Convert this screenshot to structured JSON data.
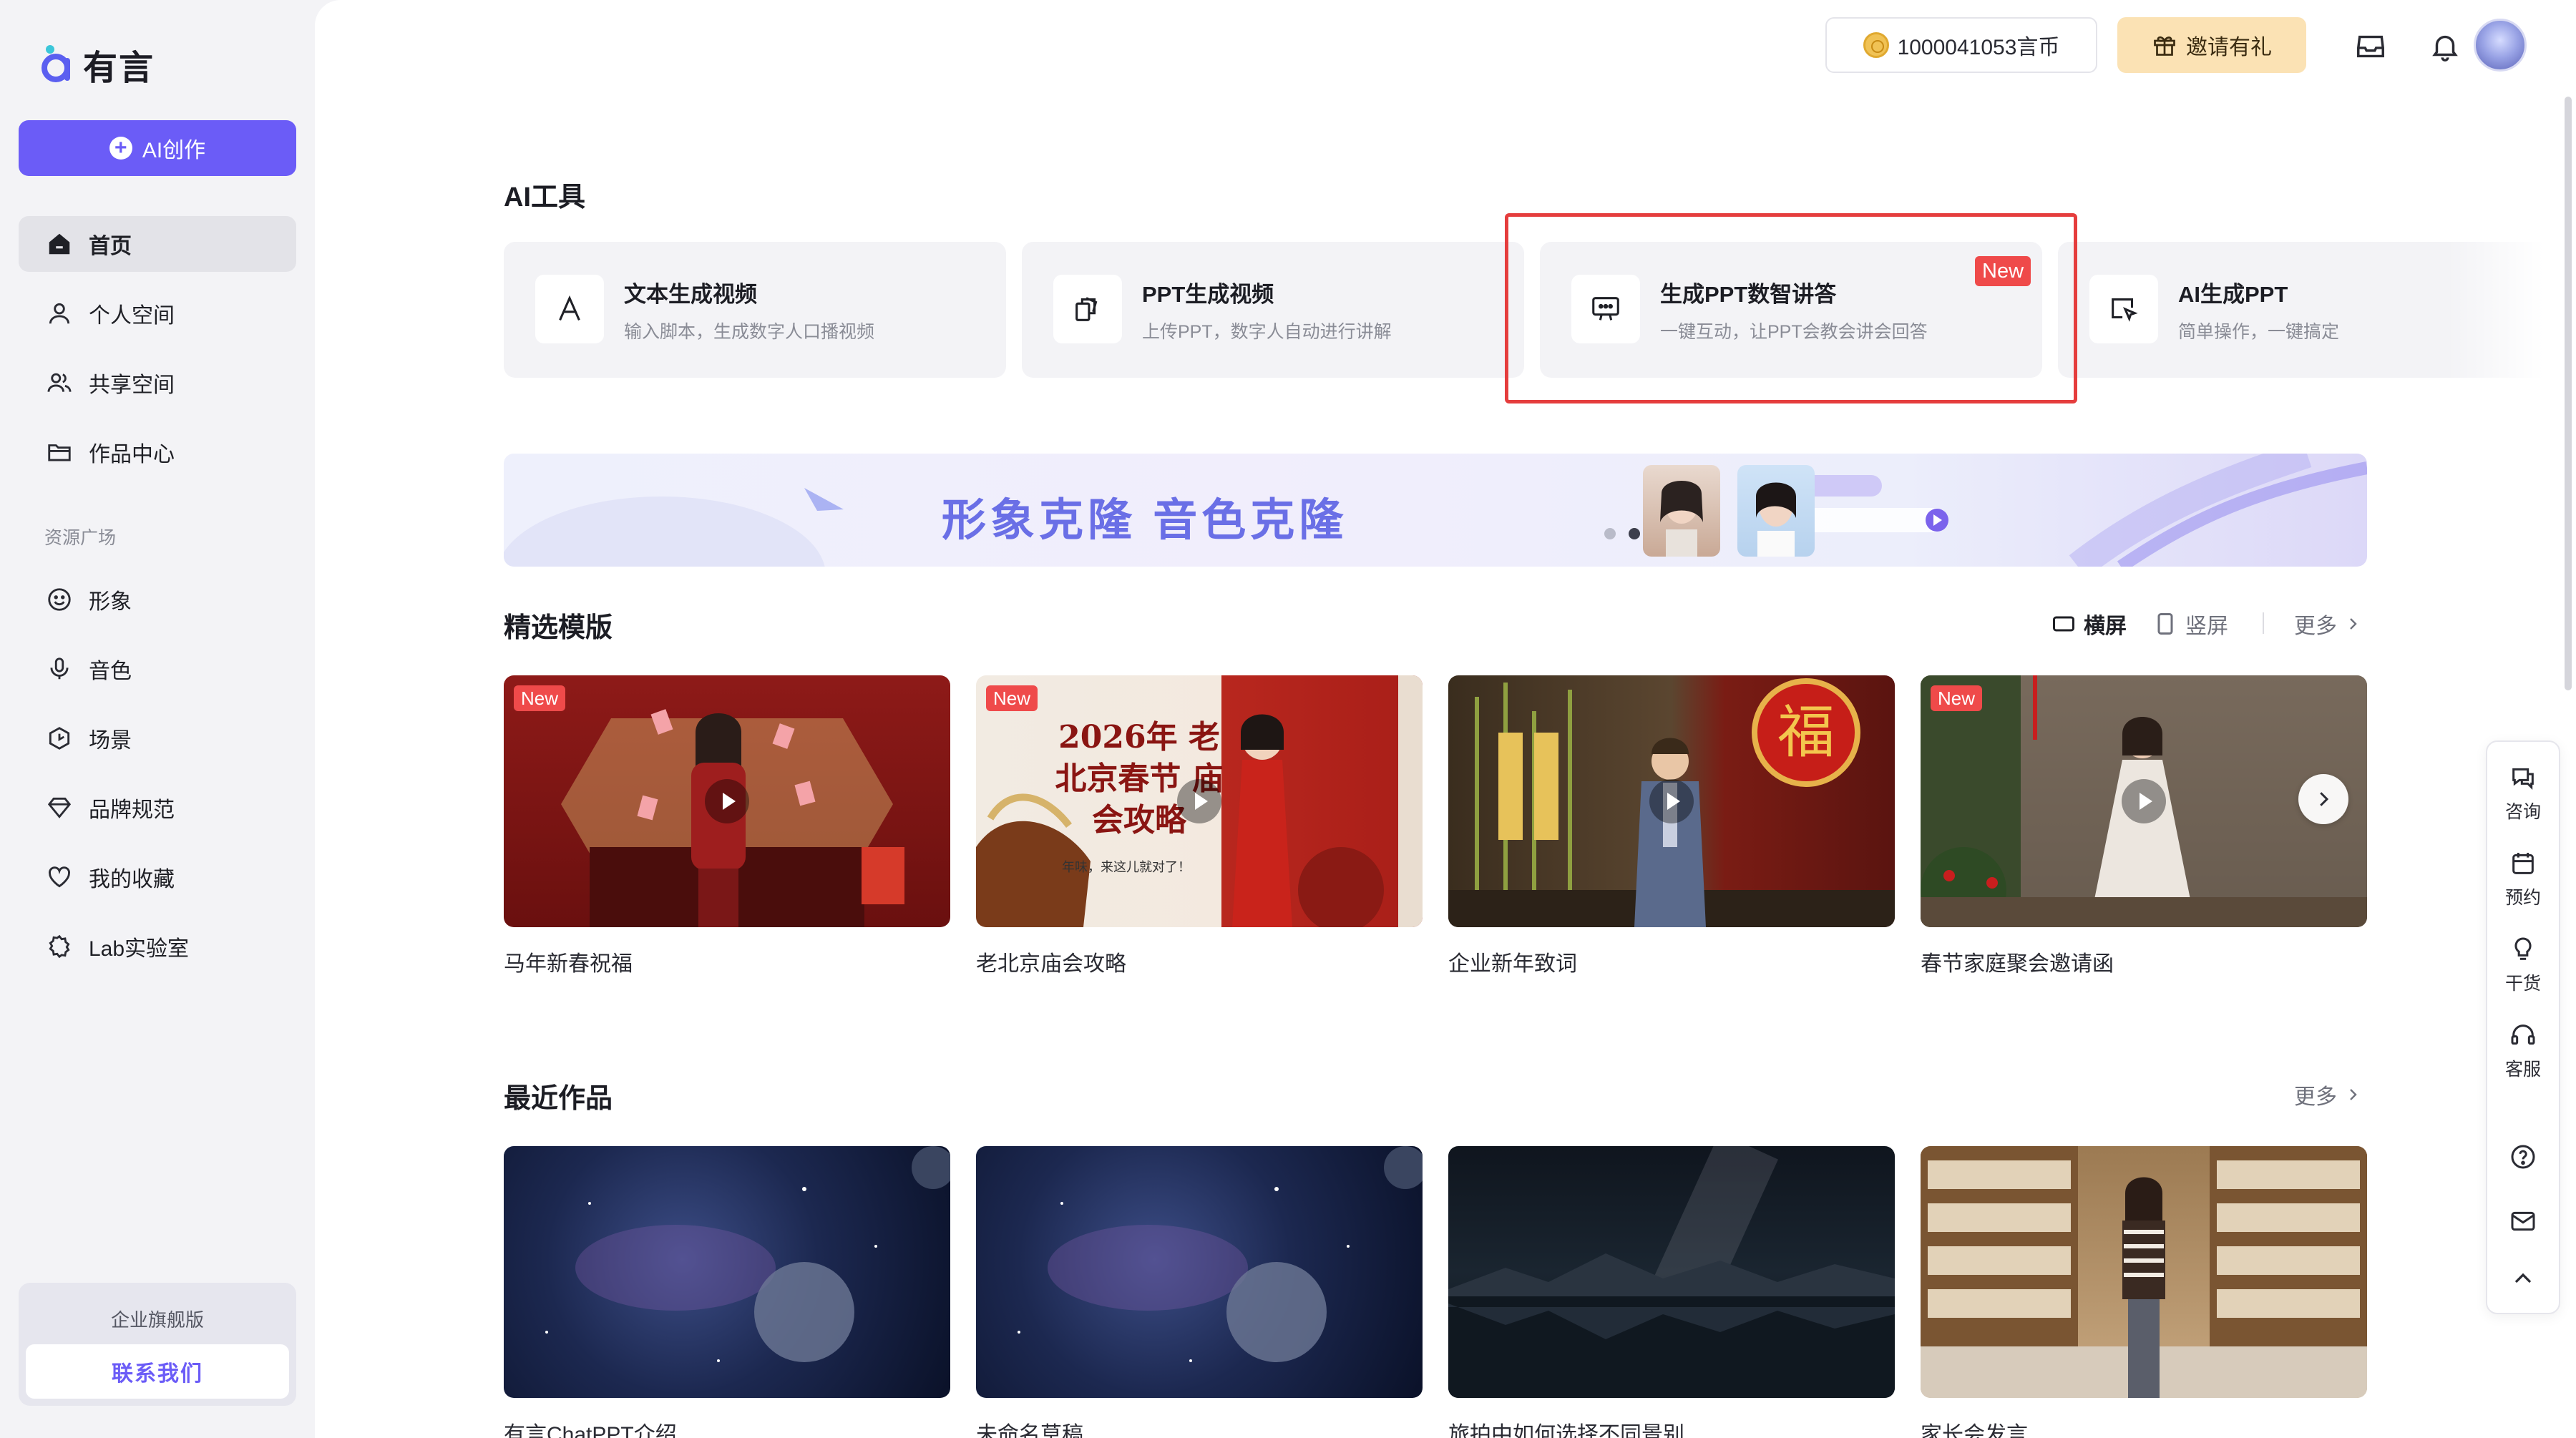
{
  "brand": {
    "name": "有言"
  },
  "sidebar": {
    "create_label": "AI创作",
    "items": [
      {
        "label": "首页",
        "icon": "home-icon"
      },
      {
        "label": "个人空间",
        "icon": "user-icon"
      },
      {
        "label": "共享空间",
        "icon": "users-icon"
      },
      {
        "label": "作品中心",
        "icon": "folder-icon"
      }
    ],
    "resource_section": "资源广场",
    "resource_items": [
      {
        "label": "形象",
        "icon": "smile-icon"
      },
      {
        "label": "音色",
        "icon": "mic-icon"
      },
      {
        "label": "场景",
        "icon": "cube-icon"
      },
      {
        "label": "品牌规范",
        "icon": "diamond-icon"
      },
      {
        "label": "我的收藏",
        "icon": "heart-icon"
      },
      {
        "label": "Lab实验室",
        "icon": "gear-icon"
      }
    ],
    "enterprise": {
      "label": "企业旗舰版",
      "button": "联系我们"
    }
  },
  "topbar": {
    "coins": "1000041053言币",
    "invite": "邀请有礼"
  },
  "ai_tools": {
    "title": "AI工具",
    "cards": [
      {
        "title": "文本生成视频",
        "desc": "输入脚本，生成数字人口播视频",
        "icon": "text-a-icon"
      },
      {
        "title": "PPT生成视频",
        "desc": "上传PPT，数字人自动进行讲解",
        "icon": "slides-icon"
      },
      {
        "title": "生成PPT数智讲答",
        "desc": "一键互动，让PPT会教会讲会回答",
        "icon": "presentation-chat-icon",
        "badge": "New"
      },
      {
        "title": "AI生成PPT",
        "desc": "简单操作，一键搞定",
        "icon": "cursor-slide-icon"
      }
    ]
  },
  "banner": {
    "text": "形象克隆  音色克隆"
  },
  "featured": {
    "title": "精选模版",
    "view_landscape": "横屏",
    "view_portrait": "竖屏",
    "more": "更多",
    "templates": [
      {
        "name": "马年新春祝福",
        "badge": "New"
      },
      {
        "name": "老北京庙会攻略",
        "badge": "New"
      },
      {
        "name": "企业新年致词",
        "badge": ""
      },
      {
        "name": "春节家庭聚会邀请函",
        "badge": "New"
      }
    ],
    "poster_text": "2026年 老北京春节 庙会攻略",
    "poster_sub": "年味，来这儿就对了！",
    "fu_text": "福"
  },
  "recent": {
    "title": "最近作品",
    "more": "更多",
    "works": [
      {
        "name": "有言ChatPPT介绍"
      },
      {
        "name": "未命名草稿"
      },
      {
        "name": "旅拍中如何选择不同景别"
      },
      {
        "name": "家长会发言"
      }
    ]
  },
  "float_panel": {
    "items": [
      {
        "label": "咨询",
        "icon": "consult-icon"
      },
      {
        "label": "预约",
        "icon": "calendar-icon"
      },
      {
        "label": "干货",
        "icon": "bulb-icon"
      },
      {
        "label": "客服",
        "icon": "headset-icon"
      }
    ]
  },
  "colors": {
    "accent": "#6b5cf7",
    "badge": "#ef4a4a",
    "highlight": "#e53d3d"
  }
}
